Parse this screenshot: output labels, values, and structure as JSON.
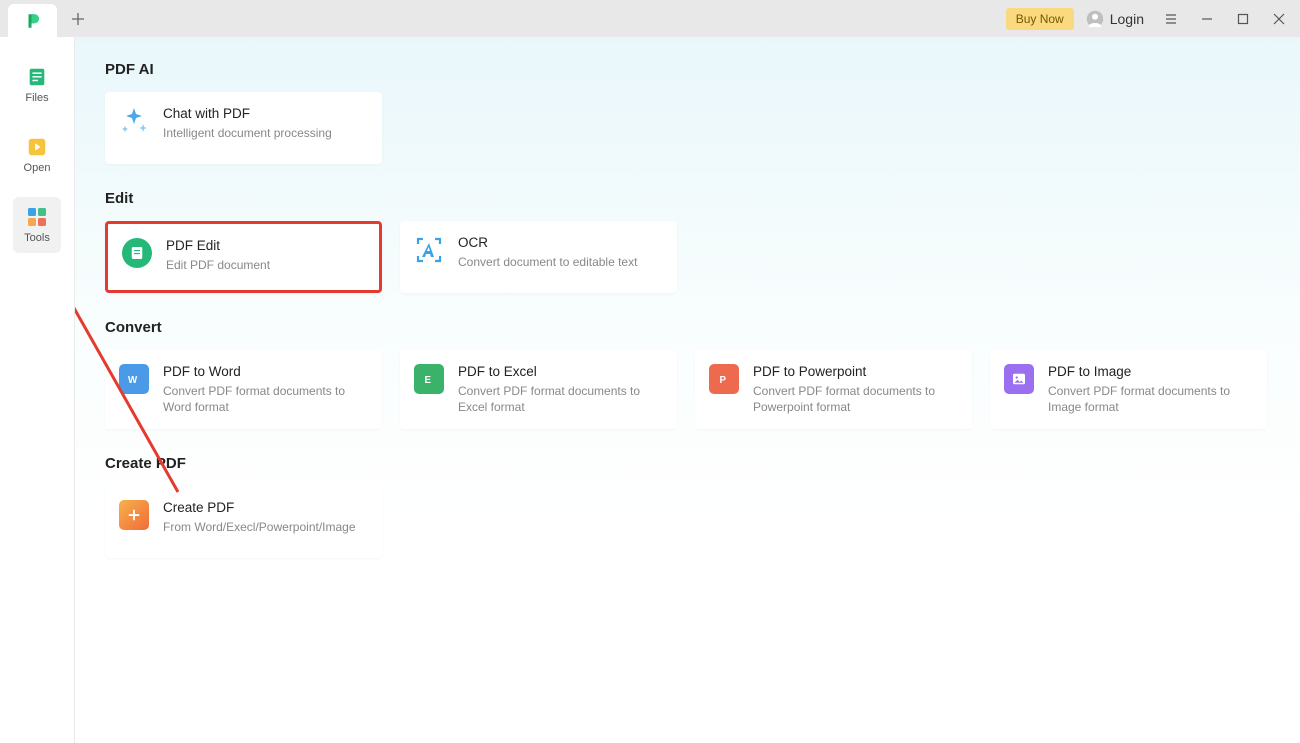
{
  "titlebar": {
    "buy_now": "Buy Now",
    "login": "Login"
  },
  "sidebar": {
    "items": [
      {
        "label": "Files"
      },
      {
        "label": "Open"
      },
      {
        "label": "Tools"
      }
    ]
  },
  "sections": {
    "pdf_ai": {
      "title": "PDF AI",
      "cards": [
        {
          "title": "Chat with PDF",
          "desc": "Intelligent document processing"
        }
      ]
    },
    "edit": {
      "title": "Edit",
      "cards": [
        {
          "title": "PDF Edit",
          "desc": "Edit PDF document"
        },
        {
          "title": "OCR",
          "desc": "Convert document to editable text"
        }
      ]
    },
    "convert": {
      "title": "Convert",
      "cards": [
        {
          "title": "PDF to Word",
          "desc": "Convert PDF format documents to Word format"
        },
        {
          "title": "PDF to Excel",
          "desc": "Convert PDF format documents to Excel format"
        },
        {
          "title": "PDF to Powerpoint",
          "desc": "Convert PDF format documents to Powerpoint format"
        },
        {
          "title": "PDF to Image",
          "desc": "Convert PDF format documents to Image format"
        }
      ]
    },
    "create": {
      "title": "Create PDF",
      "cards": [
        {
          "title": "Create PDF",
          "desc": "From Word/Execl/Powerpoint/Image"
        }
      ]
    }
  }
}
